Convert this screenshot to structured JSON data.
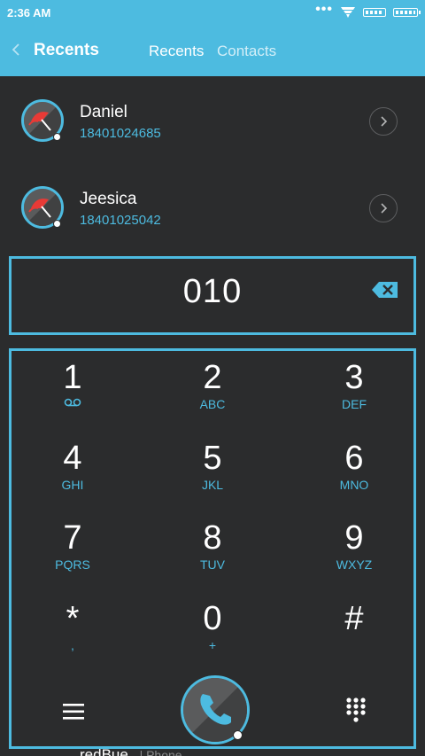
{
  "status": {
    "time": "2:36 AM",
    "more": "•••"
  },
  "header": {
    "title": "Recents",
    "tabs": [
      {
        "label": "Recents"
      },
      {
        "label": "Contacts"
      }
    ]
  },
  "recents": [
    {
      "name": "Daniel",
      "number": "18401024685"
    },
    {
      "name": "Jeesica",
      "number": "18401025042"
    }
  ],
  "dialer": {
    "entered": "010"
  },
  "keypad": {
    "keys": [
      {
        "digit": "1",
        "letters": ""
      },
      {
        "digit": "2",
        "letters": "ABC"
      },
      {
        "digit": "3",
        "letters": "DEF"
      },
      {
        "digit": "4",
        "letters": "GHI"
      },
      {
        "digit": "5",
        "letters": "JKL"
      },
      {
        "digit": "6",
        "letters": "MNO"
      },
      {
        "digit": "7",
        "letters": "PQRS"
      },
      {
        "digit": "8",
        "letters": "TUV"
      },
      {
        "digit": "9",
        "letters": "WXYZ"
      },
      {
        "digit": "*",
        "letters": ","
      },
      {
        "digit": "0",
        "letters": "+"
      },
      {
        "digit": "#",
        "letters": ""
      }
    ]
  },
  "peek": {
    "name": "redBue",
    "sub": "| Phone"
  },
  "colors": {
    "accent": "#4dbbe0",
    "background": "#2b2c2d"
  },
  "icons": [
    "back-icon",
    "wifi-icon",
    "signal-icon",
    "battery-icon",
    "chevron-right-icon",
    "backspace-icon",
    "voicemail-icon",
    "menu-icon",
    "call-icon",
    "dialpad-icon"
  ]
}
